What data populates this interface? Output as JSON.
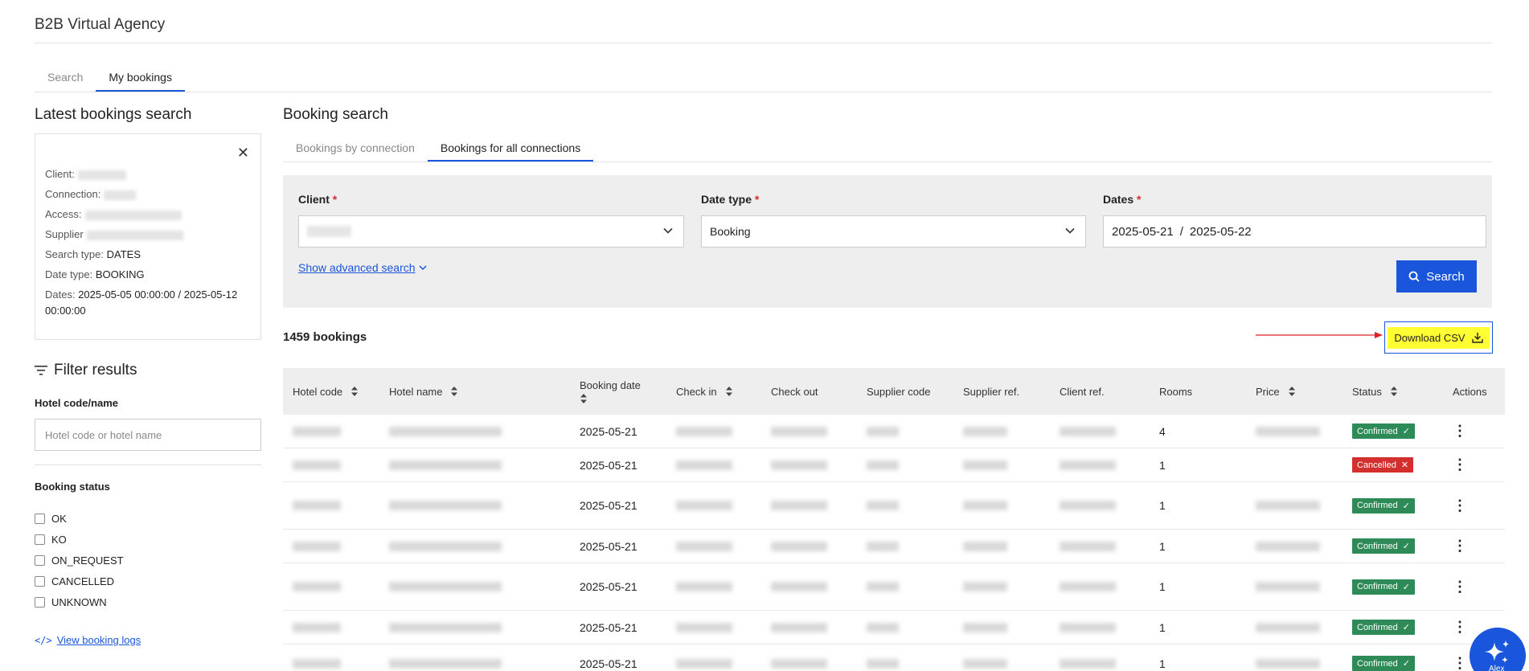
{
  "app": {
    "title": "B2B Virtual Agency"
  },
  "main_tabs": [
    {
      "label": "Search",
      "active": false
    },
    {
      "label": "My bookings",
      "active": true
    }
  ],
  "latest": {
    "title": "Latest bookings search",
    "client_label": "Client:",
    "connection_label": "Connection:",
    "access_label": "Access:",
    "supplier_label": "Supplier",
    "search_type_label": "Search type:",
    "search_type_value": "DATES",
    "date_type_label": "Date type:",
    "date_type_value": "BOOKING",
    "dates_label": "Dates:",
    "dates_value": "2025-05-05 00:00:00 / 2025-05-12 00:00:00"
  },
  "filter": {
    "title": "Filter results",
    "hotel_label": "Hotel code/name",
    "hotel_placeholder": "Hotel code or hotel name",
    "status_label": "Booking status",
    "statuses": [
      "OK",
      "KO",
      "ON_REQUEST",
      "CANCELLED",
      "UNKNOWN"
    ],
    "view_logs": "View booking logs"
  },
  "booking_search": {
    "title": "Booking search",
    "tabs": [
      {
        "label": "Bookings by connection",
        "active": false
      },
      {
        "label": "Bookings for all connections",
        "active": true
      }
    ],
    "client_label": "Client",
    "date_type_label": "Date type",
    "date_type_value": "Booking",
    "dates_label": "Dates",
    "date_from": "2025-05-21",
    "date_sep": "/",
    "date_to": "2025-05-22",
    "advanced": "Show advanced search",
    "search_button": "Search"
  },
  "results": {
    "count": "1459 bookings",
    "download": "Download CSV"
  },
  "table": {
    "columns": [
      "Hotel code",
      "Hotel name",
      "Booking date",
      "Check in",
      "Check out",
      "Supplier code",
      "Supplier ref.",
      "Client ref.",
      "Rooms",
      "Price",
      "Status",
      "Actions"
    ],
    "rows": [
      {
        "booking_date": "2025-05-21",
        "rooms": "4",
        "status": "Confirmed",
        "status_kind": "ok"
      },
      {
        "booking_date": "2025-05-21",
        "rooms": "1",
        "status": "Cancelled",
        "status_kind": "cx"
      },
      {
        "booking_date": "2025-05-21",
        "rooms": "1",
        "status": "Confirmed",
        "status_kind": "ok"
      },
      {
        "booking_date": "2025-05-21",
        "rooms": "1",
        "status": "Confirmed",
        "status_kind": "ok"
      },
      {
        "booking_date": "2025-05-21",
        "rooms": "1",
        "status": "Confirmed",
        "status_kind": "ok"
      },
      {
        "booking_date": "2025-05-21",
        "rooms": "1",
        "status": "Confirmed",
        "status_kind": "ok"
      },
      {
        "booking_date": "2025-05-21",
        "rooms": "1",
        "status": "Confirmed",
        "status_kind": "ok"
      }
    ]
  },
  "assistant": {
    "label": "Alex"
  },
  "colors": {
    "accent": "#1a56db",
    "confirmed": "#2e8b57",
    "cancelled": "#d32f2f",
    "highlight": "#ffff33"
  }
}
